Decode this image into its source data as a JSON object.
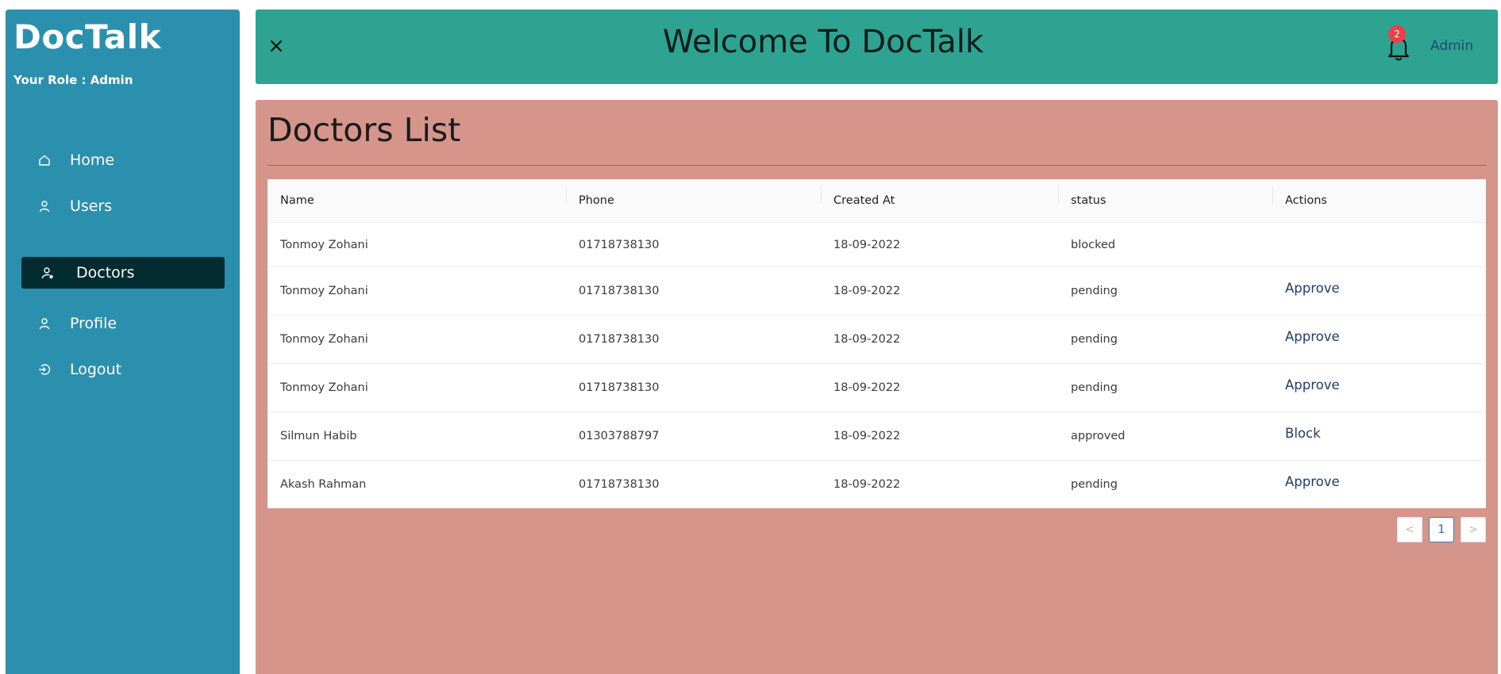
{
  "sidebar": {
    "brand": "DocTalk",
    "role": "Your Role : Admin",
    "items": [
      {
        "label": "Home",
        "icon": "home-icon"
      },
      {
        "label": "Users",
        "icon": "user-icon"
      },
      {
        "label": "Doctors",
        "icon": "doctor-icon",
        "active": true
      },
      {
        "label": "Profile",
        "icon": "user-icon"
      },
      {
        "label": "Logout",
        "icon": "logout-icon"
      }
    ]
  },
  "header": {
    "title": "Welcome To DocTalk",
    "notification_count": "2",
    "user_label": "Admin"
  },
  "main": {
    "title": "Doctors List",
    "table": {
      "columns": [
        "Name",
        "Phone",
        "Created At",
        "status",
        "Actions"
      ],
      "rows": [
        {
          "name": "Tonmoy Zohani",
          "phone": "01718738130",
          "created": "18-09-2022",
          "status": "blocked",
          "action": ""
        },
        {
          "name": "Tonmoy Zohani",
          "phone": "01718738130",
          "created": "18-09-2022",
          "status": "pending",
          "action": "Approve"
        },
        {
          "name": "Tonmoy Zohani",
          "phone": "01718738130",
          "created": "18-09-2022",
          "status": "pending",
          "action": "Approve"
        },
        {
          "name": "Tonmoy Zohani",
          "phone": "01718738130",
          "created": "18-09-2022",
          "status": "pending",
          "action": "Approve"
        },
        {
          "name": "Silmun Habib",
          "phone": "01303788797",
          "created": "18-09-2022",
          "status": "approved",
          "action": "Block"
        },
        {
          "name": "Akash Rahman",
          "phone": "01718738130",
          "created": "18-09-2022",
          "status": "pending",
          "action": "Approve"
        }
      ]
    },
    "pagination": {
      "prev": "<",
      "current": "1",
      "next": ">"
    }
  },
  "colors": {
    "sidebar_bg": "#2a90ad",
    "header_bg": "#2fa391",
    "panel_bg": "#d5958b",
    "active_item_bg": "#022c30",
    "badge_bg": "#ef3f4a",
    "action_link": "#1e3e6a"
  }
}
